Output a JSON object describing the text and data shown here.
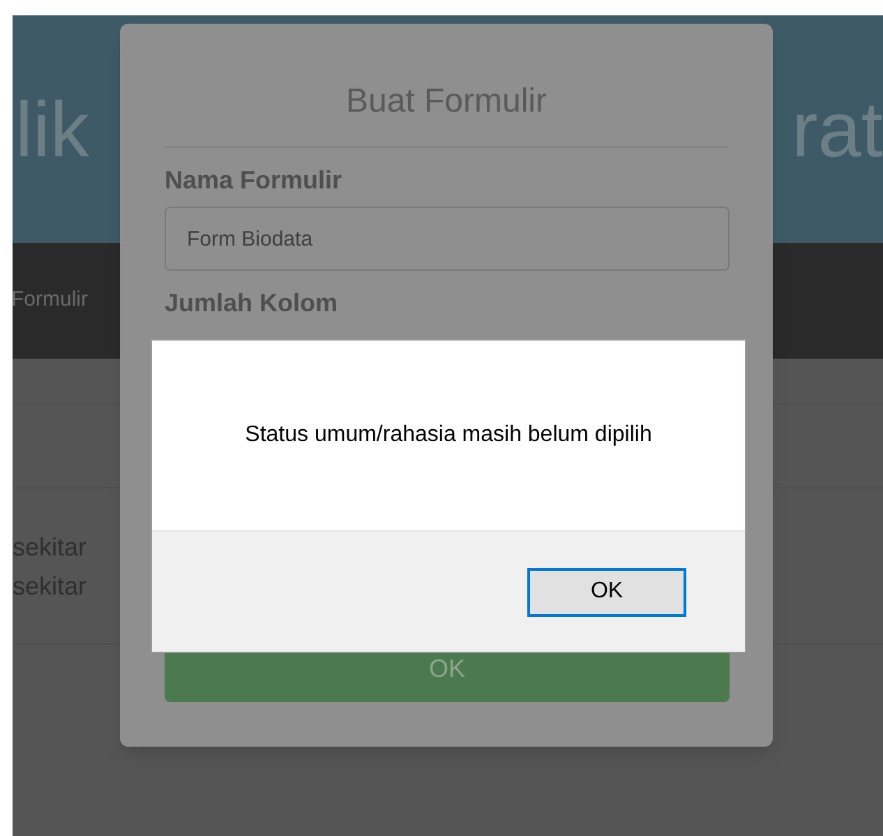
{
  "page": {
    "header_left": "lik",
    "header_right": "rat",
    "nav_item": "Formulir",
    "lines": [
      "sekitar",
      "sekitar"
    ]
  },
  "modal": {
    "title": "Buat Formulir",
    "fields": [
      {
        "label": "Nama Formulir",
        "value": "Form Biodata"
      },
      {
        "label": "Jumlah Kolom"
      }
    ],
    "submit": "OK"
  },
  "alert": {
    "message": "Status umum/rahasia masih belum dipilih",
    "button": {
      "label": "OK",
      "focused": true
    }
  }
}
